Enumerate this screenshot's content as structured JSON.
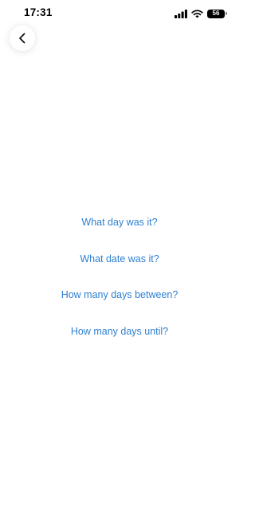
{
  "status_bar": {
    "time": "17:31",
    "battery_level": "56",
    "icons": [
      "signal-icon",
      "wifi-icon",
      "battery-icon"
    ]
  },
  "navigation": {
    "back_icon": "chevron-left-icon"
  },
  "menu": {
    "items": [
      {
        "label": "What day was it?"
      },
      {
        "label": "What date was it?"
      },
      {
        "label": "How many days between?"
      },
      {
        "label": "How many days until?"
      }
    ]
  },
  "colors": {
    "link": "#2f80d1",
    "background": "#ffffff"
  }
}
